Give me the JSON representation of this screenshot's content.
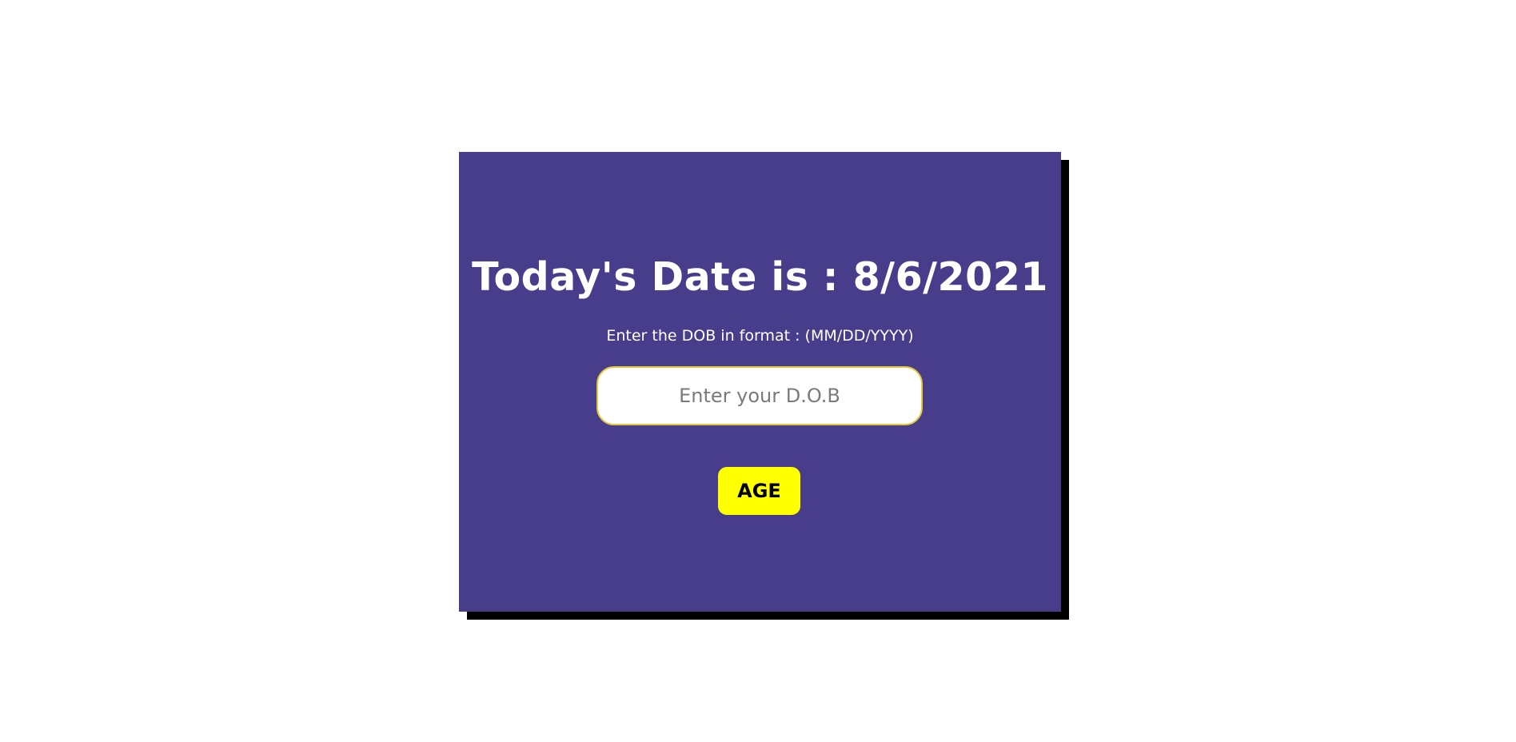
{
  "heading": "Today's Date is : 8/6/2021",
  "instruction": "Enter the DOB in format : (MM/DD/YYYY)",
  "dob_input": {
    "placeholder": "Enter your D.O.B",
    "value": ""
  },
  "age_button_label": "AGE",
  "colors": {
    "card_background": "#483d8b",
    "card_shadow": "#000000",
    "button_background": "#ffff00",
    "input_border": "#e5c83d",
    "heading_text": "#ffffff"
  }
}
